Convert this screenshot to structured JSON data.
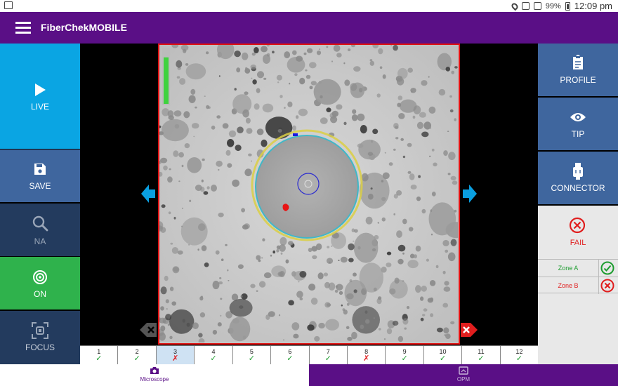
{
  "status": {
    "battery": "99%",
    "time": "12:09 pm"
  },
  "app": {
    "title": "FiberChekMOBILE"
  },
  "left_buttons": [
    {
      "label": "LIVE",
      "icon": "play-icon",
      "color": "#0aa5e3"
    },
    {
      "label": "SAVE",
      "icon": "save-icon",
      "color": "#3f669e"
    },
    {
      "label": "NA",
      "icon": "search-icon",
      "color": "#233b5e"
    },
    {
      "label": "ON",
      "icon": "target-icon",
      "color": "#2fb24c"
    },
    {
      "label": "FOCUS",
      "icon": "focus-icon",
      "color": "#233b5e"
    }
  ],
  "right_buttons": [
    {
      "label": "PROFILE",
      "icon": "clipboard-icon"
    },
    {
      "label": "TIP",
      "icon": "eye-icon"
    },
    {
      "label": "CONNECTOR",
      "icon": "connector-icon"
    }
  ],
  "result": {
    "label": "FAIL",
    "zones": [
      {
        "name": "Zone A",
        "status": "pass"
      },
      {
        "name": "Zone B",
        "status": "fail"
      }
    ]
  },
  "fibers": [
    {
      "num": "1",
      "status": "pass"
    },
    {
      "num": "2",
      "status": "pass"
    },
    {
      "num": "3",
      "status": "fail",
      "selected": true
    },
    {
      "num": "4",
      "status": "pass"
    },
    {
      "num": "5",
      "status": "pass"
    },
    {
      "num": "6",
      "status": "pass"
    },
    {
      "num": "7",
      "status": "pass"
    },
    {
      "num": "8",
      "status": "fail"
    },
    {
      "num": "9",
      "status": "pass"
    },
    {
      "num": "10",
      "status": "pass"
    },
    {
      "num": "11",
      "status": "pass"
    },
    {
      "num": "12",
      "status": "pass"
    }
  ],
  "tabs": [
    {
      "label": "Microscope",
      "icon": "camera-icon"
    },
    {
      "label": "OPM",
      "icon": "meter-icon"
    }
  ],
  "colors": {
    "appbar": "#5a0f86",
    "pass": "#1c9c2e",
    "fail": "#e01e1e",
    "arrow_blue": "#0a9fe0"
  },
  "focus_level": 0.85
}
